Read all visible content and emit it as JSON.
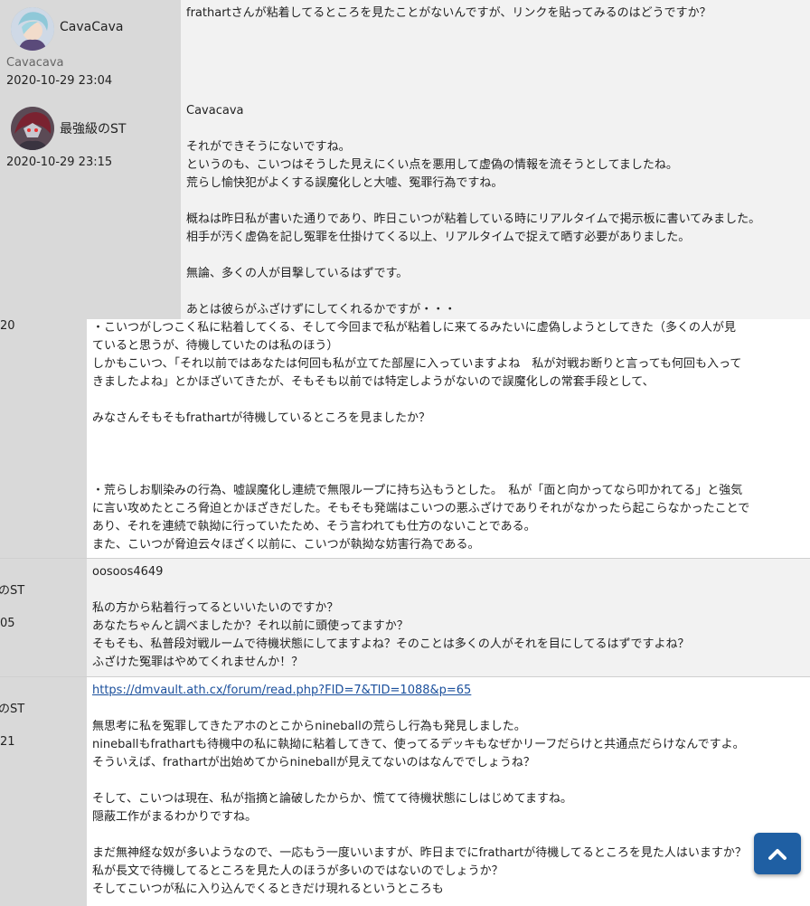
{
  "post1": {
    "author": "CavaCava",
    "user_id": "Cavacava",
    "date": "2020-10-29 23:04",
    "lines": [
      "frathartさんが粘着してるところを見たことがないんですが、リンクを貼ってみるのはどうですか？"
    ]
  },
  "post2": {
    "author": "最強級のST",
    "date": "2020-10-29 23:15",
    "reply_to": "Cavacava",
    "lines": [
      "それができそうにないですね。",
      "というのも、こいつはそうした見えにくい点を悪用して虚偽の情報を流そうとしてましたね。",
      "荒らし愉快犯がよくする誤魔化しと大嘘、冤罪行為ですね。",
      "",
      "概ねは昨日私が書いた通りであり、昨日こいつが粘着している時にリアルタイムで掲示板に書いてみました。",
      "相手が汚く虚偽を記し冤罪を仕掛けてくる以上、リアルタイムで捉えて晒す必要がありました。",
      "",
      "無論、多くの人が目撃しているはずです。",
      "",
      "あとは彼らがふざけずにしてくれるかですが・・・"
    ]
  },
  "post3": {
    "side_fragment": "20",
    "lines": [
      "・こいつがしつこく私に粘着してくる、そして今回まで私が粘着しに来てるみたいに虚偽しようとしてきた（多くの人が見",
      "ていると思うが、待機していたのは私のほう）",
      "しかもこいつ、「それ以前ではあなたは何回も私が立てた部屋に入っていますよね　私が対戦お断りと言っても何回も入って",
      "きましたよね」とかほざいてきたが、そもそも以前では特定しようがないので誤魔化しの常套手段として、",
      "",
      "みなさんそもそもfrathartが待機しているところを見ましたか？",
      "",
      "",
      "",
      "・荒らしお馴染みの行為、嘘誤魔化し連続で無限ループに持ち込もうとした。　私が「面と向かってなら叩かれてる」と強気",
      "に言い攻めたところ脅迫とかほざきだした。そもそも発端はこいつの悪ふざけでありそれがなかったら起こらなかったことで",
      "あり、それを連続で執拗に行っていたため、そう言われても仕方のないことである。",
      "また、こいつが脅迫云々ほざく以前に、こいつが執拗な妨害行為である。"
    ]
  },
  "post4": {
    "side_name_fragment": "のST",
    "side_date_fragment": "05",
    "reply_to": "oosoos4649",
    "lines": [
      "私の方から粘着行ってるといいたいのですか？",
      "あなたちゃんと調べましたか？それ以前に頭使ってますか？",
      "そもそも、私普段対戦ルームで待機状態にしてますよね？そのことは多くの人がそれを目にしてるはずですよね？",
      "ふざけた冤罪はやめてくれませんか！？"
    ]
  },
  "post5": {
    "side_name_fragment": "のST",
    "side_date_fragment": "21",
    "link": "https://dmvault.ath.cx/forum/read.php?FID=7&TID=1088&p=65",
    "lines": [
      "無思考に私を冤罪してきたアホのとこからnineballの荒らし行為も発見しました。",
      "nineballもfrathartも待機中の私に執拗に粘着してきて、使ってるデッキもなぜかリーフだらけと共通点だらけなんですよ。",
      "そういえば、frathartが出始めてからnineballが見えてないのはなんででしょうね？",
      "",
      "そして、こいつは現在、私が指摘と論破したからか、慌てて待機状態にしはじめてますね。",
      "隠蔽工作がまるわかりですね。",
      "",
      "まだ無神経な奴が多いようなので、一応もう一度いいますが、昨日までにfrathartが待機してるところを見た人はいますか？",
      "私が長文で待機してるところを見た人のほうが多いのではないのでしょうか？",
      "そしてこいつが私に入り込んでくるときだけ現れるというところも"
    ]
  },
  "icons": {
    "scroll_top": "chevron-up-icon",
    "accent": "#1f5fa3"
  }
}
